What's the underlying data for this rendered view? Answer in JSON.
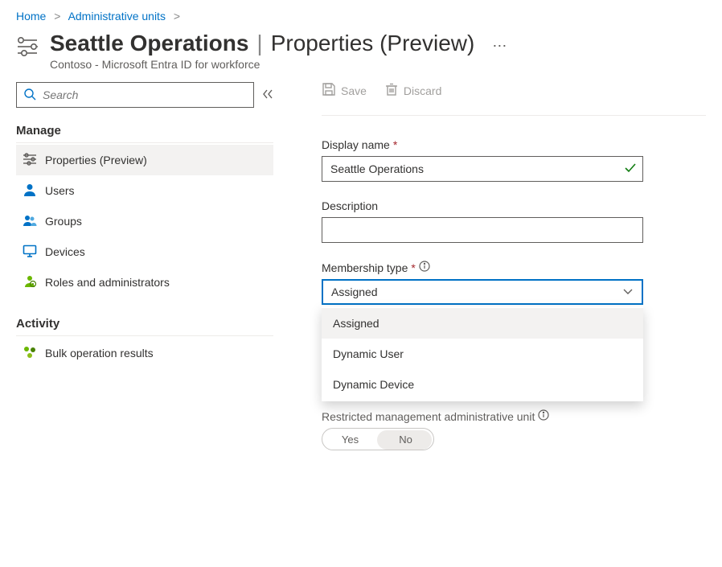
{
  "breadcrumb": {
    "home": "Home",
    "admin_units": "Administrative units"
  },
  "header": {
    "title_bold": "Seattle Operations",
    "title_light": "Properties (Preview)",
    "subtitle": "Contoso - Microsoft Entra ID for workforce"
  },
  "search": {
    "placeholder": "Search"
  },
  "nav": {
    "manage_title": "Manage",
    "activity_title": "Activity",
    "items": {
      "properties": "Properties (Preview)",
      "users": "Users",
      "groups": "Groups",
      "devices": "Devices",
      "roles": "Roles and administrators",
      "bulk": "Bulk operation results"
    }
  },
  "toolbar": {
    "save": "Save",
    "discard": "Discard"
  },
  "form": {
    "display_name_label": "Display name",
    "display_name_value": "Seattle Operations",
    "description_label": "Description",
    "description_value": "",
    "membership_type_label": "Membership type",
    "membership_type_value": "Assigned",
    "membership_options": [
      "Assigned",
      "Dynamic User",
      "Dynamic Device"
    ],
    "restricted_label": "Restricted management administrative unit",
    "toggle_yes": "Yes",
    "toggle_no": "No"
  }
}
